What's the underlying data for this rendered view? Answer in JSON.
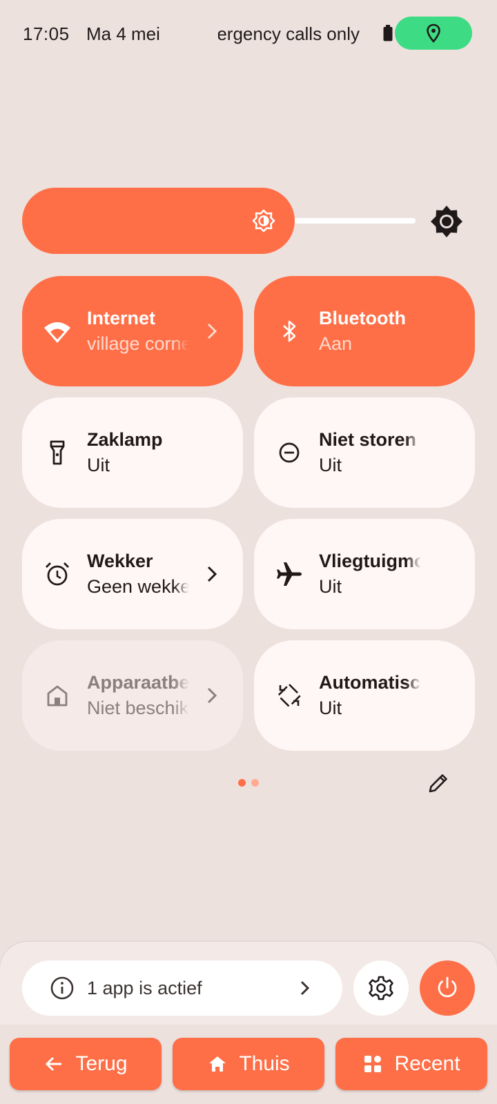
{
  "status_bar": {
    "time": "17:05",
    "date": "Ma 4 mei",
    "carrier": "Emergency calls only",
    "location_indicator_color": "#3ddc84"
  },
  "brightness": {
    "level": 0.72,
    "auto_icon": "auto-brightness-icon"
  },
  "tiles": [
    {
      "title": "Internet",
      "subtitle": "village corner",
      "state": "on",
      "icon": "wifi-icon",
      "chevron": true
    },
    {
      "title": "Bluetooth",
      "subtitle": "Aan",
      "state": "on",
      "icon": "bluetooth-icon",
      "chevron": false
    },
    {
      "title": "Zaklamp",
      "subtitle": "Uit",
      "state": "off",
      "icon": "flashlight-icon",
      "chevron": false
    },
    {
      "title": "Niet storen",
      "subtitle": "Uit",
      "state": "off",
      "icon": "do-not-disturb-icon",
      "chevron": false
    },
    {
      "title": "Wekker",
      "subtitle": "Geen wekker",
      "state": "off",
      "icon": "alarm-icon",
      "chevron": true
    },
    {
      "title": "Vliegtuigmodus",
      "subtitle": "Uit",
      "state": "off",
      "icon": "airplane-icon",
      "chevron": false
    },
    {
      "title": "Apparaatbediening",
      "subtitle": "Niet beschikbaar",
      "state": "disabled",
      "icon": "home-icon",
      "chevron": true
    },
    {
      "title": "Automatisch draaien",
      "subtitle": "Uit",
      "state": "off",
      "icon": "auto-rotate-icon",
      "chevron": false
    }
  ],
  "pager": {
    "pages": 2,
    "current": 1
  },
  "footer": {
    "active_apps_label": "1 app is actief"
  },
  "navbar": {
    "back_label": "Terug",
    "home_label": "Thuis",
    "recent_label": "Recent"
  },
  "colors": {
    "accent": "#ff6f47",
    "background": "#ede1de",
    "tile_off": "#fff7f5"
  }
}
